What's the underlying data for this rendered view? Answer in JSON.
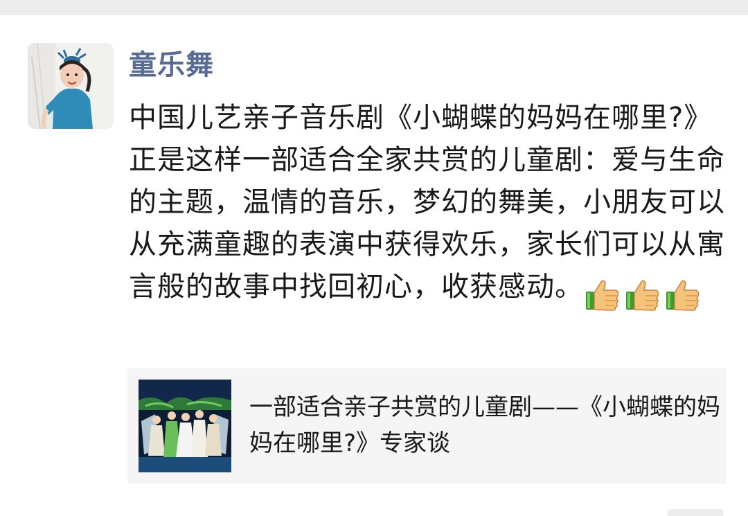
{
  "post": {
    "author": "童乐舞",
    "text": "中国儿艺亲子音乐剧《小蝴蝶的妈妈在哪里?》正是这样一部适合全家共赏的儿童剧：爱与生命的主题，温情的音乐，梦幻的舞美，小朋友可以从充满童趣的表演中获得欢乐，家长们可以从寓言般的故事中找回初心，收获感动。",
    "emojis": [
      "thumbs-up-icon",
      "thumbs-up-icon",
      "thumbs-up-icon"
    ]
  },
  "link_card": {
    "title": "一部适合亲子共赏的儿童剧——《小蝴蝶的妈妈在哪里?》专家谈"
  },
  "colors": {
    "author_name": "#576b95",
    "text": "#191919",
    "card_bg": "#f5f5f5",
    "top_strip": "#ededed"
  }
}
